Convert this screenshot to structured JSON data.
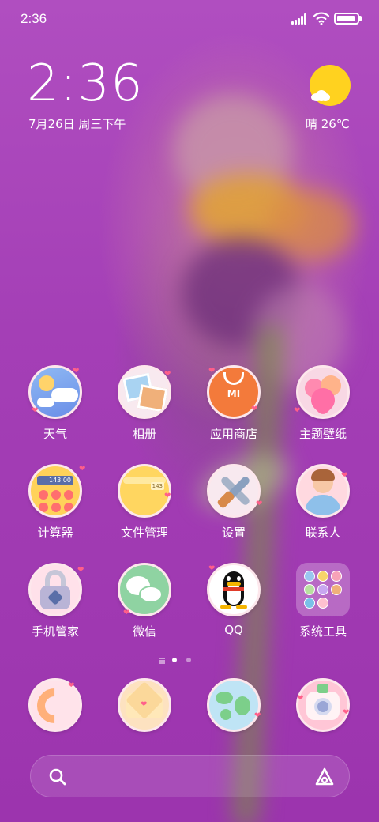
{
  "status_bar": {
    "time": "2:36",
    "icons": [
      "signal-icon",
      "wifi-icon",
      "battery-icon"
    ],
    "battery_level": 0.9
  },
  "clock_widget": {
    "time": "2:36",
    "date": "7月26日 周三下午",
    "weather_text": "晴 26℃",
    "weather_icon": "sunny-cloud-icon"
  },
  "apps_row1": [
    {
      "label": "天气",
      "icon": "weather-icon"
    },
    {
      "label": "相册",
      "icon": "gallery-icon"
    },
    {
      "label": "应用商店",
      "icon": "app-store-icon"
    },
    {
      "label": "主题壁纸",
      "icon": "themes-icon"
    }
  ],
  "apps_row2": [
    {
      "label": "计算器",
      "icon": "calculator-icon",
      "display": "143.00"
    },
    {
      "label": "文件管理",
      "icon": "file-manager-icon",
      "badge": "143"
    },
    {
      "label": "设置",
      "icon": "settings-icon"
    },
    {
      "label": "联系人",
      "icon": "contacts-icon"
    }
  ],
  "apps_row3": [
    {
      "label": "手机管家",
      "icon": "security-icon"
    },
    {
      "label": "微信",
      "icon": "wechat-icon"
    },
    {
      "label": "QQ",
      "icon": "qq-icon"
    },
    {
      "label": "系统工具",
      "icon": "folder-icon"
    }
  ],
  "dock": [
    {
      "icon": "phone-icon"
    },
    {
      "icon": "messages-icon"
    },
    {
      "icon": "browser-icon"
    },
    {
      "icon": "camera-icon"
    }
  ],
  "page_indicator": {
    "pages": 2,
    "current": 1
  },
  "search_bar": {
    "left_icon": "search-icon",
    "right_icon": "assistant-icon"
  },
  "colors": {
    "background": "#a43fb6",
    "sun": "#ffd21f",
    "heart": "#ff5f8a",
    "icon_border": "#fde7ec"
  }
}
